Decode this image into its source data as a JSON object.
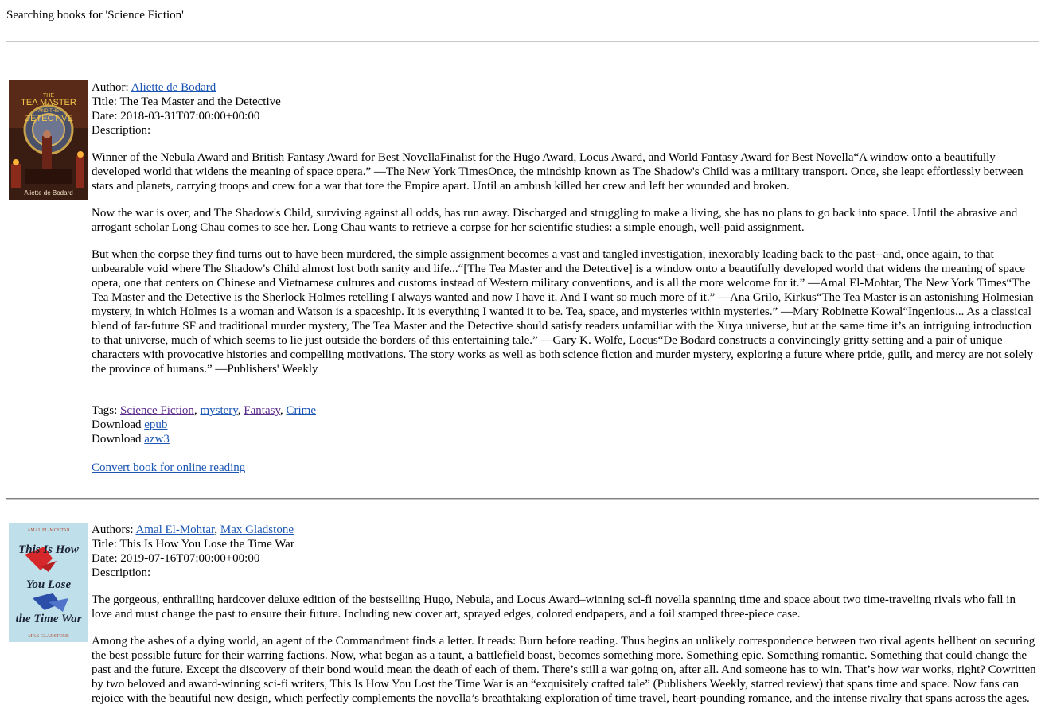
{
  "heading": "Searching books for 'Science Fiction'",
  "book1": {
    "author_label": "Author: ",
    "author": "Aliette de Bodard",
    "title_line": "Title: The Tea Master and the Detective",
    "date_line": "Date: 2018-03-31T07:00:00+00:00",
    "description_label": "Description:",
    "para1": "Winner of the Nebula Award and British Fantasy Award for Best NovellaFinalist for the Hugo Award, Locus Award, and World Fantasy Award for Best Novella“A window onto a beautifully developed world that widens the meaning of space opera.” —The New York TimesOnce, the mindship known as The Shadow's Child was a military transport. Once, she leapt effortlessly between stars and planets, carrying troops and crew for a war that tore the Empire apart. Until an ambush killed her crew and left her wounded and broken.",
    "para2": "Now the war is over, and The Shadow's Child, surviving against all odds, has run away. Discharged and struggling to make a living, she has no plans to go back into space. Until the abrasive and arrogant scholar Long Chau comes to see her. Long Chau wants to retrieve a corpse for her scientific studies: a simple enough, well-paid assignment.",
    "para3": "But when the corpse they find turns out to have been murdered, the simple assignment becomes a vast and tangled investigation, inexorably leading back to the past--and, once again, to that unbearable void where The Shadow's Child almost lost both sanity and life...“[The Tea Master and the Detective] is a window onto a beautifully developed world that widens the meaning of space opera, one that centers on Chinese and Vietnamese cultures and customs instead of Western military conventions, and is all the more welcome for it.” —Amal El-Mohtar, The New York Times“The Tea Master and the Detective is the Sherlock Holmes retelling I always wanted and now I have it. And I want so much more of it.” —Ana Grilo, Kirkus“The Tea Master is an astonishing Holmesian mystery, in which Holmes is a woman and Watson is a spaceship. It is everything I wanted it to be. Tea, space, and mysteries within mysteries.” —Mary Robinette Kowal“Ingenious... As a classical blend of far-future SF and traditional murder mystery, The Tea Master and the Detective should satisfy readers unfamiliar with the Xuya universe, but at the same time it’s an intriguing introduction to that universe, much of which seems to lie just outside the borders of this entertaining tale.” —Gary K. Wolfe, Locus“De Bodard constructs a convincingly gritty setting and a pair of unique characters with provocative histories and compelling motivations. The story works as well as both science fiction and murder mystery, exploring a future where pride, guilt, and mercy are not solely the province of humans.” —Publishers' Weekly",
    "tags_label": "Tags: ",
    "tags": [
      "Science Fiction",
      "mystery",
      "Fantasy",
      "Crime"
    ],
    "tag_sep": ", ",
    "download_label": "Download ",
    "download1": "epub",
    "download2": "azw3",
    "convert": "Convert book for online reading",
    "cover_text_top": "THE",
    "cover_text_main1": "TEA MASTER",
    "cover_text_mid": "AND THE",
    "cover_text_main2": "DETECTIVE",
    "cover_author": "Aliette de Bodard"
  },
  "book2": {
    "authors_label": "Authors: ",
    "author1": "Amal El-Mohtar",
    "author_sep": ", ",
    "author2": "Max Gladstone",
    "title_line": "Title: This Is How You Lose the Time War",
    "date_line": "Date: 2019-07-16T07:00:00+00:00",
    "description_label": "Description:",
    "para1": "The gorgeous, enthralling hardcover deluxe edition of the bestselling Hugo, Nebula, and Locus Award–winning sci-fi novella spanning time and space about two time-traveling rivals who fall in love and must change the past to ensure their future. Including new cover art, sprayed edges, colored endpapers, and a foil stamped three-piece case.",
    "para2": "Among the ashes of a dying world, an agent of the Commandment finds a letter. It reads: Burn before reading. Thus begins an unlikely correspondence between two rival agents hellbent on securing the best possible future for their warring factions. Now, what began as a taunt, a battlefield boast, becomes something more. Something epic. Something romantic. Something that could change the past and the future. Except the discovery of their bond would mean the death of each of them. There’s still a war going on, after all. And someone has to win. That’s how war works, right? Cowritten by two beloved and award-winning sci-fi writers, This Is How You Lost the Time War is an “exquisitely crafted tale” (Publishers Weekly, starred review) that spans time and space. Now fans can rejoice with the beautiful new design, which perfectly complements the novella’s breathtaking exploration of time travel, heart-pounding romance, and the intense rivalry that spans across the ages.",
    "cover_author_top": "AMAL EL-MOHTAR",
    "cover_line1": "This Is How",
    "cover_line2": "You Lose",
    "cover_line3": "the Time War",
    "cover_author_bottom": "MAX GLADSTONE"
  }
}
